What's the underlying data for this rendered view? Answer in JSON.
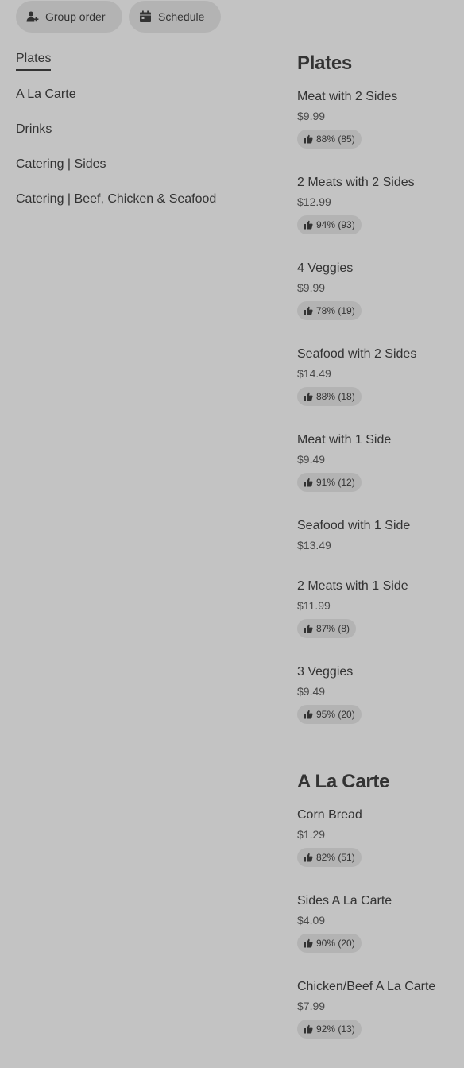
{
  "actions": {
    "group_order": "Group order",
    "schedule": "Schedule"
  },
  "nav": [
    "Plates",
    "A La Carte",
    "Drinks",
    "Catering | Sides",
    "Catering | Beef, Chicken & Seafood"
  ],
  "sections": [
    {
      "title": "Plates",
      "items": [
        {
          "name": "Meat with 2 Sides",
          "price": "$9.99",
          "rating": "88% (85)"
        },
        {
          "name": "2 Meats with 2 Sides",
          "price": "$12.99",
          "rating": "94% (93)"
        },
        {
          "name": "4 Veggies",
          "price": "$9.99",
          "rating": "78% (19)"
        },
        {
          "name": "Seafood with 2 Sides",
          "price": "$14.49",
          "rating": "88% (18)"
        },
        {
          "name": "Meat with 1 Side",
          "price": "$9.49",
          "rating": "91% (12)"
        },
        {
          "name": "Seafood with 1 Side",
          "price": "$13.49"
        },
        {
          "name": "2 Meats with 1 Side",
          "price": "$11.99",
          "rating": "87% (8)"
        },
        {
          "name": "3 Veggies",
          "price": "$9.49",
          "rating": "95% (20)"
        }
      ]
    },
    {
      "title": "A La Carte",
      "items": [
        {
          "name": "Corn Bread",
          "price": "$1.29",
          "rating": "82% (51)"
        },
        {
          "name": "Sides A La Carte",
          "price": "$4.09",
          "rating": "90% (20)"
        },
        {
          "name": "Chicken/Beef A La Carte",
          "price": "$7.99",
          "rating": "92% (13)"
        }
      ]
    }
  ]
}
